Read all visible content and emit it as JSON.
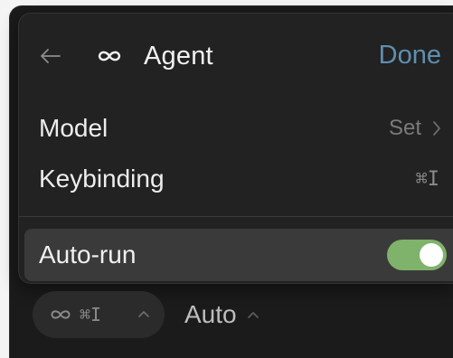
{
  "header": {
    "back_icon": "arrow-left-icon",
    "mode_icon": "infinity-icon",
    "title": "Agent",
    "done_label": "Done"
  },
  "settings": {
    "model": {
      "label": "Model",
      "value": "Set",
      "icon": "chevron-right-icon"
    },
    "keybinding": {
      "label": "Keybinding",
      "value": "⌘I"
    },
    "autorun": {
      "label": "Auto-run",
      "enabled": true
    }
  },
  "footer": {
    "pill": {
      "icon": "infinity-icon",
      "shortcut": "⌘I",
      "chevron": "chevron-up-icon"
    },
    "model_selector": {
      "label": "Auto",
      "chevron": "chevron-up-icon"
    }
  },
  "colors": {
    "accent": "#5f8fb0",
    "toggle_on": "#7fb26a",
    "panel_bg": "#222222",
    "selected_row_bg": "#3a3a3a"
  }
}
